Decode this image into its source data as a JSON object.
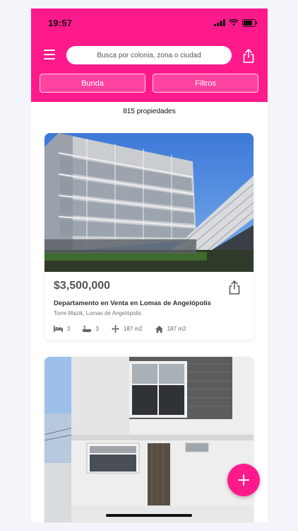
{
  "status_bar": {
    "time": "19:57"
  },
  "header": {
    "search_placeholder": "Busca por colonia, zona o ciudad",
    "chips": {
      "bunda": "Bunda",
      "filtros": "Filtros"
    },
    "menu_icon": "hamburger-menu-icon",
    "share_icon": "share-icon"
  },
  "results": {
    "count_text": "815 propiedades"
  },
  "listings": [
    {
      "price": "$3,500,000",
      "title": "Departamento en Venta en Lomas de Angelópolis",
      "location": "Torre Mazik, Lomas de Angelópolis",
      "bedrooms": "3",
      "bathrooms": "3",
      "lot_area": "187 m2",
      "built_area": "187 m2"
    },
    {
      "price": "",
      "title": "",
      "location": ""
    }
  ],
  "fab": {
    "icon": "plus-icon"
  },
  "colors": {
    "accent": "#ff1a8c",
    "price": "#555555"
  }
}
